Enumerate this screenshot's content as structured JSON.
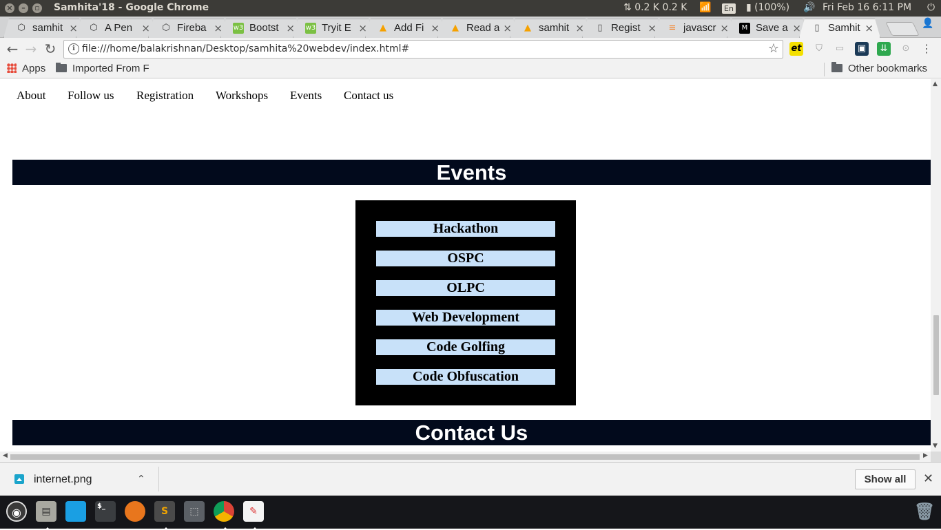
{
  "system_panel": {
    "window_title": "Samhita'18 - Google Chrome",
    "network_speed": "0.2 K 0.2 K",
    "keyboard_layout": "En",
    "battery": "(100%)",
    "clock": "Fri Feb 16  6:11 PM"
  },
  "tabs": [
    {
      "label": "samhit",
      "icon": "codepen-icon"
    },
    {
      "label": "A Pen",
      "icon": "codepen-icon"
    },
    {
      "label": "Fireba",
      "icon": "codepen-icon"
    },
    {
      "label": "Bootst",
      "icon": "w3-icon"
    },
    {
      "label": "Tryit E",
      "icon": "w3-icon"
    },
    {
      "label": "Add Fi",
      "icon": "firebase-icon"
    },
    {
      "label": "Read a",
      "icon": "firebase-icon"
    },
    {
      "label": "samhit",
      "icon": "firebase-icon"
    },
    {
      "label": "Regist",
      "icon": "page-icon"
    },
    {
      "label": "javascr",
      "icon": "stackoverflow-icon"
    },
    {
      "label": "Save a",
      "icon": "medium-icon"
    },
    {
      "label": "Samhit",
      "icon": "page-icon",
      "active": true
    }
  ],
  "toolbar": {
    "url": "file:///home/balakrishnan/Desktop/samhita%20webdev/index.html#"
  },
  "bookmarks": {
    "apps": "Apps",
    "imported": "Imported From F",
    "other": "Other bookmarks"
  },
  "site": {
    "nav": [
      "About",
      "Follow us",
      "Registration",
      "Workshops",
      "Events",
      "Contact us"
    ],
    "events_heading": "Events",
    "events": [
      "Hackathon",
      "OSPC",
      "OLPC",
      "Web Development",
      "Code Golfing",
      "Code Obfuscation"
    ],
    "contact_heading": "Contact Us"
  },
  "downloads": {
    "file": "internet.png",
    "show_all": "Show all"
  },
  "colors": {
    "section_bar": "#020a1c",
    "event_item_bg": "#c8e1f9",
    "events_box": "#000000"
  }
}
